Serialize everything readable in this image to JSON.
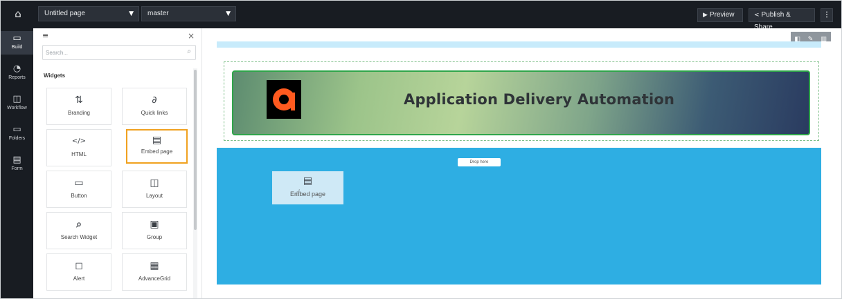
{
  "topbar": {
    "home_icon": "home-icon",
    "page_select": "Untitled page",
    "branch_select": "master",
    "preview": "Preview",
    "publish": "Publish & Share",
    "more": "⋮"
  },
  "rail": {
    "items": [
      {
        "label": "Build",
        "icon": "build-icon"
      },
      {
        "label": "Reports",
        "icon": "reports-icon"
      },
      {
        "label": "Workflow",
        "icon": "workflow-icon"
      },
      {
        "label": "Folders",
        "icon": "folders-icon"
      },
      {
        "label": "Form",
        "icon": "form-icon"
      }
    ]
  },
  "panel": {
    "search_placeholder": "Search...",
    "section_title": "Widgets",
    "widgets": [
      {
        "label": "Branding",
        "icon": "branding-icon"
      },
      {
        "label": "Quick links",
        "icon": "link-icon"
      },
      {
        "label": "HTML",
        "icon": "code-icon"
      },
      {
        "label": "Embed page",
        "icon": "document-icon"
      },
      {
        "label": "Button",
        "icon": "button-icon"
      },
      {
        "label": "Layout",
        "icon": "layout-icon"
      },
      {
        "label": "Search Widget",
        "icon": "search-icon"
      },
      {
        "label": "Group",
        "icon": "group-icon"
      },
      {
        "label": "Alert",
        "icon": "alert-icon"
      },
      {
        "label": "AdvanceGrid",
        "icon": "grid-icon"
      }
    ]
  },
  "canvas": {
    "banner_title": "Application Delivery Automation",
    "drop_hint": "Drop here",
    "drag_label": "Embed page"
  },
  "colors": {
    "accent_selected": "#f0a11f",
    "dropzone": "#2eaee3",
    "banner_border": "#2fa54a"
  }
}
